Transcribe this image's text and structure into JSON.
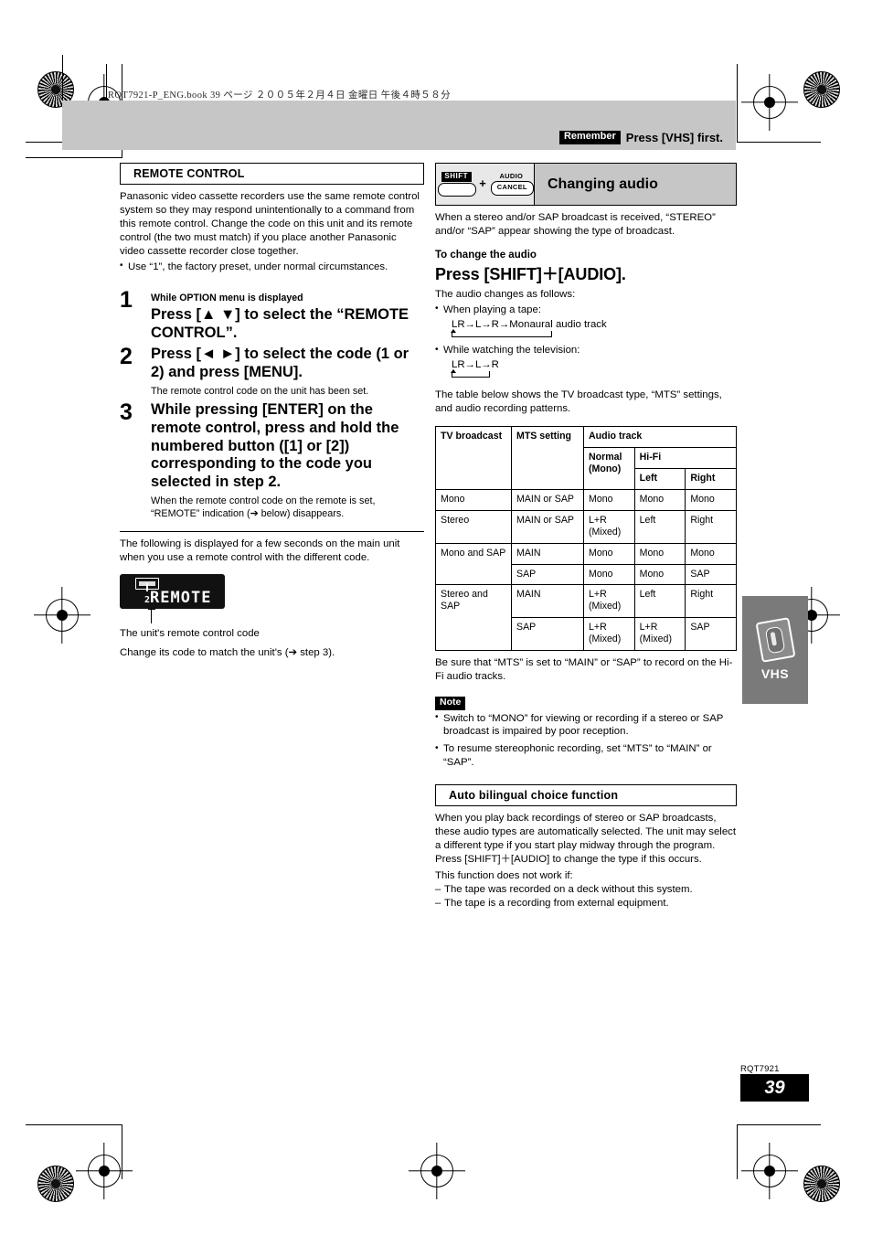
{
  "page": {
    "book_line": "RQT7921-P_ENG.book   39 ページ   ２００５年２月４日  金曜日  午後４時５８分",
    "remember_tag": "Remember",
    "remember_text": "Press [VHS] first.",
    "rqt_code": "RQT7921",
    "page_number": "39"
  },
  "left": {
    "section_title": "REMOTE CONTROL",
    "intro": "Panasonic video cassette recorders use the same remote control system so they may respond unintentionally to a command from this remote control. Change the code on this unit and its remote control (the two must match) if you place another Panasonic video cassette recorder close together.",
    "intro_bullets": [
      "Use “1”, the factory preset, under normal circumstances."
    ],
    "steps": [
      {
        "num": "1",
        "pre": "While OPTION menu is displayed",
        "main": "Press [▲ ▼] to select the “REMOTE CONTROL”.",
        "sub": ""
      },
      {
        "num": "2",
        "pre": "",
        "main": "Press [◄ ►] to select the code (1 or 2) and press [MENU].",
        "sub": "The remote control code on the unit has been set."
      },
      {
        "num": "3",
        "pre": "",
        "main": "While pressing [ENTER] on the remote control, press and hold the numbered button ([1] or [2]) corresponding to the code you selected in step 2.",
        "sub": "When the remote control code on the remote is set, “REMOTE” indication (➔ below) disappears."
      }
    ],
    "after_rule": "The following is displayed for a few seconds on the main unit when you use a remote control with the different code.",
    "lcd": {
      "code_digit": "2",
      "display_text": "REMOTE"
    },
    "callout_label": "The unit's remote control code",
    "closing": "Change its code to match the unit's (➔ step 3)."
  },
  "right": {
    "keys": {
      "shift_label": "SHIFT",
      "plus": "+",
      "audio_label": "AUDIO",
      "cancel_label": "CANCEL"
    },
    "title": "Changing audio",
    "intro": "When a stereo and/or SAP broadcast is received, “STEREO” and/or “SAP” appear showing the type of broadcast.",
    "subhead": "To change the audio",
    "bighead": "Press [SHIFT]＋[AUDIO].",
    "changes_intro": "The audio changes as follows:",
    "bullets": [
      {
        "label": "When playing a tape:",
        "flow": "LR→L→R→Monaural audio track",
        "loop_width": 108
      },
      {
        "label": "While watching the television:",
        "flow": "LR→L→R",
        "loop_width": 40
      }
    ],
    "table_intro": "The table below shows the TV broadcast type, “MTS” settings, and audio recording patterns.",
    "table_headers": {
      "tv_broadcast": "TV broadcast",
      "mts_setting": "MTS setting",
      "audio_track": "Audio track",
      "normal_mono": "Normal (Mono)",
      "hifi": "Hi-Fi",
      "left": "Left",
      "right": "Right"
    },
    "table_rows": [
      {
        "tv": "Mono",
        "span": 1,
        "mts": "MAIN or SAP",
        "normal": "Mono",
        "left": "Mono",
        "right": "Mono"
      },
      {
        "tv": "Stereo",
        "span": 1,
        "mts": "MAIN or SAP",
        "normal": "L+R (Mixed)",
        "left": "Left",
        "right": "Right"
      },
      {
        "tv": "Mono and SAP",
        "span": 2,
        "mts": "MAIN",
        "normal": "Mono",
        "left": "Mono",
        "right": "Mono"
      },
      {
        "tv": "",
        "span": 0,
        "mts": "SAP",
        "normal": "Mono",
        "left": "Mono",
        "right": "SAP"
      },
      {
        "tv": "Stereo and SAP",
        "span": 2,
        "mts": "MAIN",
        "normal": "L+R (Mixed)",
        "left": "Left",
        "right": "Right"
      },
      {
        "tv": "",
        "span": 0,
        "mts": "SAP",
        "normal": "L+R (Mixed)",
        "left": "L+R (Mixed)",
        "right": "SAP"
      }
    ],
    "table_note": "Be sure that “MTS” is set to “MAIN” or “SAP” to record on the Hi-Fi audio tracks.",
    "note_tag": "Note",
    "note_bullets": [
      "Switch to “MONO” for viewing or recording if a stereo or SAP broadcast is impaired by poor reception.",
      "To resume stereophonic recording, set “MTS” to “MAIN” or “SAP”."
    ],
    "auto_section_title": "Auto bilingual choice function",
    "auto_body": "When you play back recordings of stereo or SAP broadcasts, these audio types are automatically selected. The unit may select a different type if you start play midway through the program. Press [SHIFT]＋[AUDIO] to change the type if this occurs.",
    "auto_condition": "This function does not work if:",
    "auto_dashes": [
      "The tape was recorded on a deck without this system.",
      "The tape is a recording from external equipment."
    ]
  },
  "side_tab": {
    "label": "VHS"
  }
}
